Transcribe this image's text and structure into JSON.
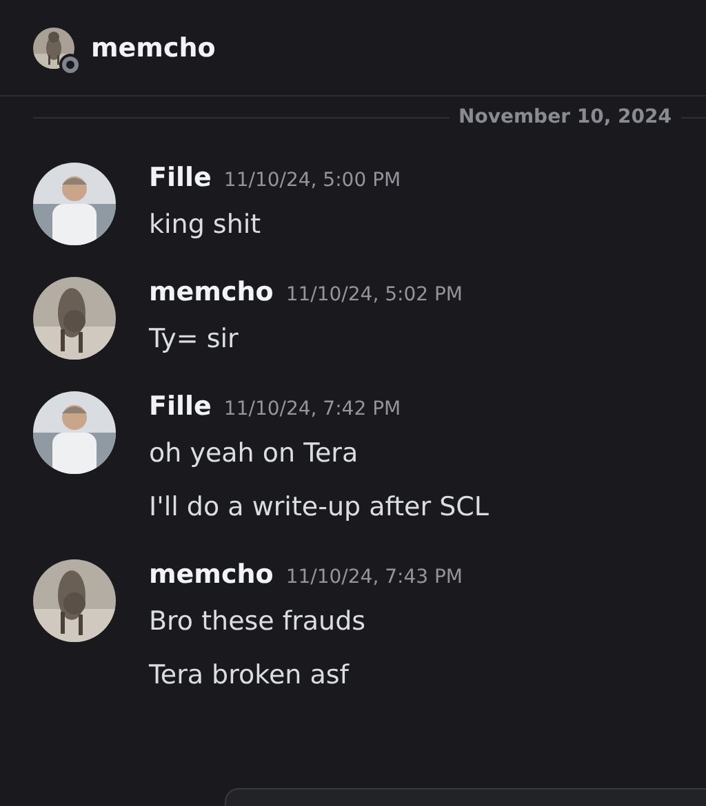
{
  "header": {
    "name": "memcho",
    "online": false,
    "avatar": {
      "kind": "picture"
    }
  },
  "date_divider": "November 10, 2024",
  "messages": [
    {
      "author": "Fille",
      "time": "11/10/24, 5:00 PM",
      "avatar": {
        "kind": "picture"
      },
      "lines": [
        "king shit"
      ]
    },
    {
      "author": "memcho",
      "time": "11/10/24, 5:02 PM",
      "avatar": {
        "kind": "picture"
      },
      "lines": [
        "Ty= sir"
      ]
    },
    {
      "author": "Fille",
      "time": "11/10/24, 7:42 PM",
      "avatar": {
        "kind": "picture"
      },
      "lines": [
        "oh yeah on Tera",
        "I'll do a write-up after SCL"
      ]
    },
    {
      "author": "memcho",
      "time": "11/10/24, 7:43 PM",
      "avatar": {
        "kind": "picture"
      },
      "lines": [
        "Bro these frauds",
        "Tera broken asf"
      ]
    }
  ]
}
